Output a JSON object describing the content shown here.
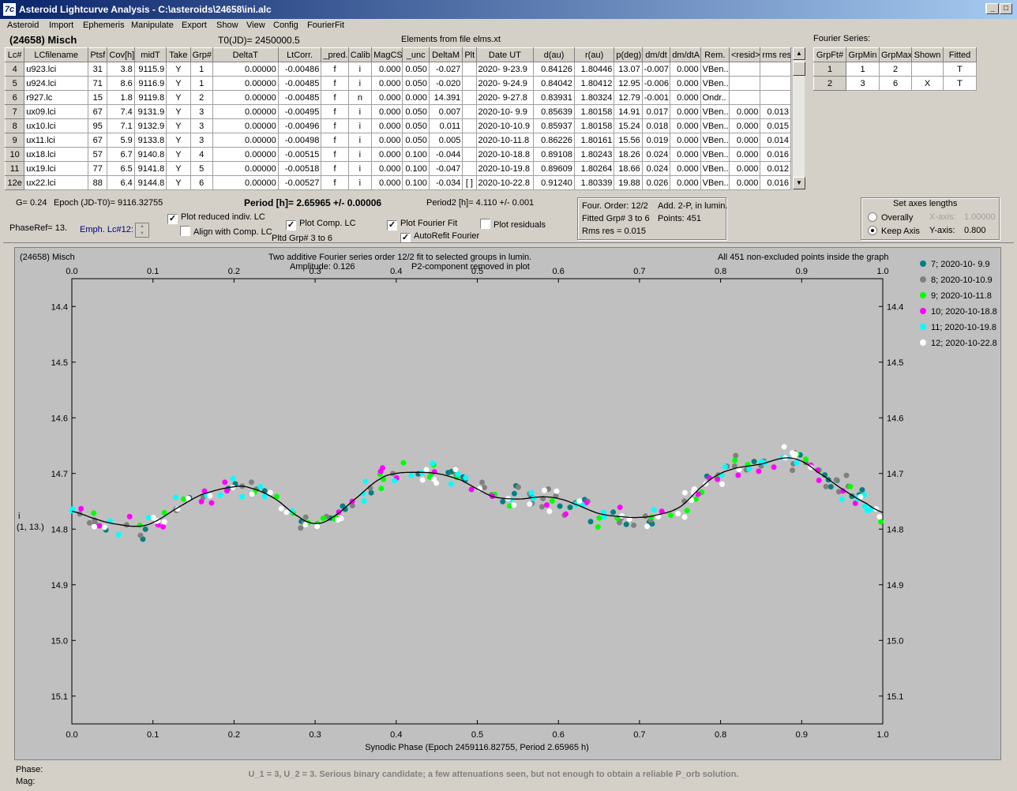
{
  "window": {
    "title": "Asteroid Lightcurve Analysis - C:\\asteroids\\24658\\ini.alc",
    "app_icon": "7c",
    "buttons": {
      "minimize": "_",
      "maximize": "□",
      "close": "×"
    }
  },
  "menu": [
    "Asteroid",
    "Import",
    "Ephemeris",
    "Manipulate",
    "Export",
    "Show",
    "View",
    "Config",
    "FourierFit"
  ],
  "header": {
    "asteroid_name": "(24658) Misch",
    "t0": "T0(JD)= 2450000.5",
    "elements_source": "Elements from file elms.xt",
    "fourier_series_label": "Fourier Series:"
  },
  "lc_table": {
    "columns": [
      "Lc#",
      "LCfilename",
      "Ptsf",
      "Cov[h]",
      "midT",
      "Take",
      "Grp#",
      "DeltaT",
      "LtCorr.",
      "_pred.",
      "Calib",
      "MagCS",
      "_unc",
      "DeltaM",
      "Plt",
      "Date UT",
      "d(au)",
      "r(au)",
      "p(deg)",
      "dm/dt",
      "dm/dtA",
      "Rem.",
      "<resid>",
      "rms res"
    ],
    "rows": [
      [
        "4",
        "u923.lci",
        "31",
        "3.8",
        "9115.9",
        "Y",
        "1",
        "0.00000",
        "-0.00486",
        "f",
        "i",
        "0.000",
        "0.050",
        "-0.027",
        "",
        "2020- 9-23.9",
        "0.84126",
        "1.80446",
        "13.07",
        "-0.007",
        "0.000",
        "VBen..",
        "",
        ""
      ],
      [
        "5",
        "u924.lci",
        "71",
        "8.6",
        "9116.9",
        "Y",
        "1",
        "0.00000",
        "-0.00485",
        "f",
        "i",
        "0.000",
        "0.050",
        "-0.020",
        "",
        "2020- 9-24.9",
        "0.84042",
        "1.80412",
        "12.95",
        "-0.006",
        "0.000",
        "VBen..",
        "",
        ""
      ],
      [
        "6",
        "r927.lc",
        "15",
        "1.8",
        "9119.8",
        "Y",
        "2",
        "0.00000",
        "-0.00485",
        "f",
        "n",
        "0.000",
        "0.000",
        "14.391",
        "",
        "2020- 9-27.8",
        "0.83931",
        "1.80324",
        "12.79",
        "-0.001",
        "0.000",
        "Ondr..",
        "",
        ""
      ],
      [
        "7",
        "ux09.lci",
        "67",
        "7.4",
        "9131.9",
        "Y",
        "3",
        "0.00000",
        "-0.00495",
        "f",
        "i",
        "0.000",
        "0.050",
        "0.007",
        "",
        "2020-10- 9.9",
        "0.85639",
        "1.80158",
        "14.91",
        "0.017",
        "0.000",
        "VBen..",
        "0.000",
        "0.013"
      ],
      [
        "8",
        "ux10.lci",
        "95",
        "7.1",
        "9132.9",
        "Y",
        "3",
        "0.00000",
        "-0.00496",
        "f",
        "i",
        "0.000",
        "0.050",
        "0.011",
        "",
        "2020-10-10.9",
        "0.85937",
        "1.80158",
        "15.24",
        "0.018",
        "0.000",
        "VBen..",
        "0.000",
        "0.015"
      ],
      [
        "9",
        "ux11.lci",
        "67",
        "5.9",
        "9133.8",
        "Y",
        "3",
        "0.00000",
        "-0.00498",
        "f",
        "i",
        "0.000",
        "0.050",
        "0.005",
        "",
        "2020-10-11.8",
        "0.86226",
        "1.80161",
        "15.56",
        "0.019",
        "0.000",
        "VBen..",
        "0.000",
        "0.014"
      ],
      [
        "10",
        "ux18.lci",
        "57",
        "6.7",
        "9140.8",
        "Y",
        "4",
        "0.00000",
        "-0.00515",
        "f",
        "i",
        "0.000",
        "0.100",
        "-0.044",
        "",
        "2020-10-18.8",
        "0.89108",
        "1.80243",
        "18.26",
        "0.024",
        "0.000",
        "VBen..",
        "0.000",
        "0.016"
      ],
      [
        "11",
        "ux19.lci",
        "77",
        "6.5",
        "9141.8",
        "Y",
        "5",
        "0.00000",
        "-0.00518",
        "f",
        "i",
        "0.000",
        "0.100",
        "-0.047",
        "",
        "2020-10-19.8",
        "0.89609",
        "1.80264",
        "18.66",
        "0.024",
        "0.000",
        "VBen..",
        "0.000",
        "0.012"
      ],
      [
        "12e",
        "ux22.lci",
        "88",
        "6.4",
        "9144.8",
        "Y",
        "6",
        "0.00000",
        "-0.00527",
        "f",
        "i",
        "0.000",
        "0.100",
        "-0.034",
        "[ ]",
        "2020-10-22.8",
        "0.91240",
        "1.80339",
        "19.88",
        "0.026",
        "0.000",
        "VBen..",
        "0.000",
        "0.016"
      ]
    ]
  },
  "fourier_table": {
    "columns": [
      "GrpFt#",
      "GrpMin",
      "GrpMax",
      "Shown",
      "Fitted"
    ],
    "rows": [
      [
        "1",
        "1",
        "2",
        "",
        "T"
      ],
      [
        "2",
        "3",
        "6",
        "X",
        "T"
      ]
    ]
  },
  "status": {
    "g": "G= 0.24",
    "epoch": "Epoch (JD-T0)= 9116.32755",
    "period": "Period [h]= 2.65965 +/- 0.00006",
    "period2": "Period2 [h]= 4.110 +/- 0.001",
    "phaseref": "PhaseRef= 13.",
    "emph_lc": "Emph. Lc#12:"
  },
  "checkboxes": {
    "plot_reduced": {
      "label": "Plot reduced indiv. LC",
      "checked": true
    },
    "align_comp": {
      "label": "Align with Comp. LC",
      "checked": false
    },
    "plot_comp": {
      "label": "Plot Comp. LC",
      "checked": true
    },
    "pltd_grp": "Pltd Grp#  3  to  6",
    "plot_fourier": {
      "label": "Plot Fourier Fit",
      "checked": true
    },
    "autorefit": {
      "label": "AutoRefit Fourier",
      "checked": true
    },
    "plot_residuals": {
      "label": "Plot residuals",
      "checked": false
    }
  },
  "fourier_info": {
    "order": "Four. Order: 12/2",
    "add": "Add. 2-P, in lumin.",
    "fitted": "Fitted Grp# 3 to 6",
    "points": "Points: 451",
    "rms": "Rms res      = 0.015"
  },
  "axes_box": {
    "title": "Set axes lengths",
    "overally": "Overally",
    "keep_axis": "Keep Axis",
    "x_label": "X-axis:",
    "x_value": "1.00000",
    "y_label": "Y-axis:",
    "y_value": "0.800"
  },
  "plot": {
    "top_left": "(24658) Misch",
    "title_line1": "Two additive Fourier series order 12/2 fit to selected groups in lumin.",
    "title_line2_a": "Amplitude: 0.126",
    "title_line2_b": "P2-component removed in plot",
    "top_right": "All 451 non-excluded points inside the graph",
    "ylabel_line1": "i",
    "ylabel_line2": "(1, 13.)"
  },
  "chart_data": {
    "type": "scatter",
    "xlabel": "Synodic Phase (Epoch 2459116.82755, Period 2.65965 h)",
    "xlim": [
      0,
      1
    ],
    "ylim": [
      14.35,
      15.15
    ],
    "y_inverted": true,
    "x_ticks": [
      "0.0",
      "0.1",
      "0.2",
      "0.3",
      "0.4",
      "0.5",
      "0.6",
      "0.7",
      "0.8",
      "0.9",
      "1.0"
    ],
    "y_ticks": [
      "14.4",
      "14.5",
      "14.6",
      "14.7",
      "14.8",
      "14.9",
      "15.0",
      "15.1"
    ],
    "legend_position": "right",
    "fit_curve": {
      "x": [
        0.0,
        0.03,
        0.05,
        0.08,
        0.1,
        0.13,
        0.16,
        0.2,
        0.22,
        0.25,
        0.28,
        0.3,
        0.32,
        0.35,
        0.38,
        0.4,
        0.42,
        0.45,
        0.48,
        0.5,
        0.52,
        0.55,
        0.58,
        0.6,
        0.62,
        0.65,
        0.68,
        0.7,
        0.72,
        0.75,
        0.78,
        0.8,
        0.82,
        0.85,
        0.88,
        0.9,
        0.92,
        0.95,
        0.98,
        1.0
      ],
      "y": [
        14.768,
        14.782,
        14.79,
        14.795,
        14.788,
        14.762,
        14.738,
        14.724,
        14.726,
        14.745,
        14.778,
        14.79,
        14.78,
        14.745,
        14.71,
        14.7,
        14.698,
        14.7,
        14.712,
        14.728,
        14.742,
        14.746,
        14.742,
        14.745,
        14.755,
        14.772,
        14.778,
        14.779,
        14.775,
        14.76,
        14.72,
        14.7,
        14.69,
        14.683,
        14.672,
        14.678,
        14.698,
        14.728,
        14.754,
        14.77
      ]
    },
    "series": [
      {
        "name": "7; 2020-10- 9.9",
        "color": "#008080"
      },
      {
        "name": "8; 2020-10-10.9",
        "color": "#808080"
      },
      {
        "name": "9; 2020-10-11.8",
        "color": "#00ff00"
      },
      {
        "name": "10; 2020-10-18.8",
        "color": "#ff00ff"
      },
      {
        "name": "11; 2020-10-19.8",
        "color": "#00ffff"
      },
      {
        "name": "12; 2020-10-22.8",
        "color": "#ffffff"
      }
    ]
  },
  "bottom": {
    "phase": "Phase:",
    "mag": "Mag:",
    "note": "U_1 = 3, U_2 = 3. Serious binary candidate; a few attenuations seen, but not enough to obtain a reliable P_orb solution."
  }
}
